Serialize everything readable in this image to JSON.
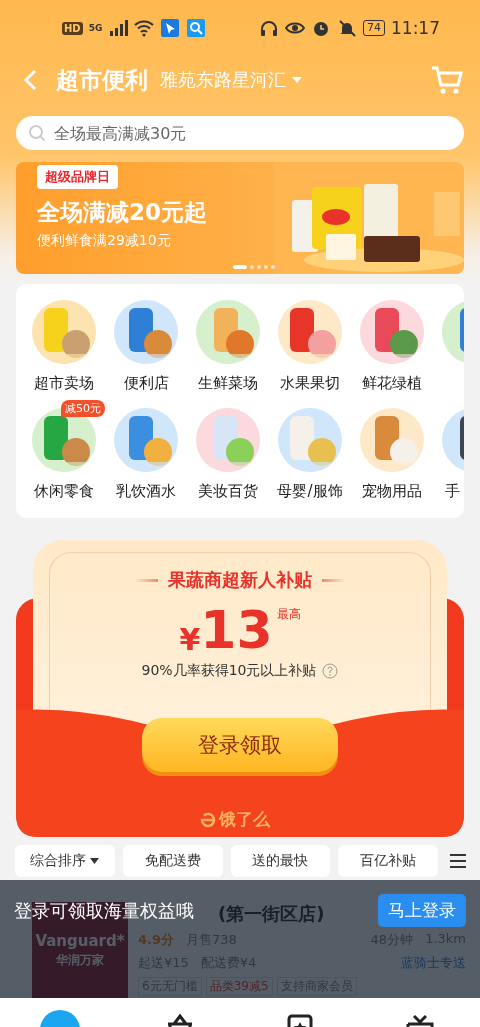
{
  "status_bar": {
    "hd": "HD",
    "network": "5G",
    "battery": "74",
    "time": "11:17"
  },
  "header": {
    "title": "超市便利",
    "location": "雅苑东路星河汇"
  },
  "search": {
    "placeholder": "全场最高满减30元"
  },
  "banner": {
    "tag": "超级品牌日",
    "headline": "全场满减20元起",
    "subline": "便利鲜食满29减10元",
    "dots": [
      {
        "selected": true
      },
      {
        "selected": false
      },
      {
        "selected": false
      },
      {
        "selected": false
      },
      {
        "selected": false
      }
    ]
  },
  "categories": [
    {
      "label": "超市卖场"
    },
    {
      "label": "便利店"
    },
    {
      "label": "生鲜菜场"
    },
    {
      "label": "水果果切"
    },
    {
      "label": "鲜花绿植"
    },
    {
      "kind": "picture"
    },
    {
      "label": "休闲零食",
      "badge": "减50元"
    },
    {
      "label": "乳饮酒水"
    },
    {
      "label": "美妆百货"
    },
    {
      "label": "母婴/服饰"
    },
    {
      "label": "宠物用品"
    },
    {
      "label": "手"
    }
  ],
  "coupon": {
    "title": "果蔬商超新人补贴",
    "currency": "¥",
    "amount": "13",
    "amount_note": "最高",
    "note": "90%几率获得10元以上补贴",
    "button": "登录领取",
    "brand": "饿了么"
  },
  "filters": [
    {
      "label": "综合排序",
      "kind": "dropdown"
    },
    {
      "label": "免配送费",
      "kind": "chip"
    },
    {
      "label": "送的最快",
      "kind": "chip"
    },
    {
      "label": "百亿补贴",
      "kind": "chip"
    }
  ],
  "store": {
    "logo_name": "Vanguard",
    "logo_mark": "*",
    "logo_subtitle": "华润万家",
    "name": "(第一街区店)",
    "rating": "4.9分",
    "monthly_sales": "月售738",
    "delivery_time": "48分钟",
    "distance": "1.3km",
    "min_order": "起送¥15",
    "delivery_fee": "配送费¥4",
    "courier": "蓝骑士专送",
    "tags": [
      "6元无门槛",
      "品类39减5",
      "支持商家会员"
    ]
  },
  "login_prompt": {
    "text": "登录可领取海量权益哦",
    "button": "马上登录"
  }
}
